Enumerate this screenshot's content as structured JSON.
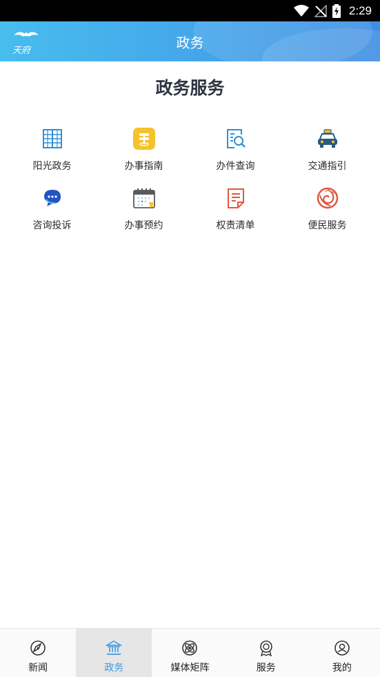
{
  "status_bar": {
    "time": "2:29"
  },
  "header": {
    "title": "政务",
    "logo_text": "天府"
  },
  "section": {
    "title": "政务服务"
  },
  "services": [
    {
      "label": "阳光政务",
      "icon": "building-grid-icon"
    },
    {
      "label": "办事指南",
      "icon": "signpost-icon"
    },
    {
      "label": "办件查询",
      "icon": "document-search-icon"
    },
    {
      "label": "交通指引",
      "icon": "taxi-icon"
    },
    {
      "label": "咨询投诉",
      "icon": "chat-bubble-icon"
    },
    {
      "label": "办事预约",
      "icon": "calendar-icon"
    },
    {
      "label": "权责清单",
      "icon": "checklist-icon"
    },
    {
      "label": "便民服务",
      "icon": "spiral-emblem-icon"
    }
  ],
  "bottom_nav": [
    {
      "label": "新闻",
      "icon": "compass-icon",
      "active": false
    },
    {
      "label": "政务",
      "icon": "government-building-icon",
      "active": true
    },
    {
      "label": "媒体矩阵",
      "icon": "media-orbit-icon",
      "active": false
    },
    {
      "label": "服务",
      "icon": "award-badge-icon",
      "active": false
    },
    {
      "label": "我的",
      "icon": "user-profile-icon",
      "active": false
    }
  ],
  "colors": {
    "header_start": "#47bdee",
    "header_end": "#3f8ee3",
    "active_tab": "#3a9be6",
    "icon_blue": "#2e8fd6",
    "icon_yellow": "#f5c22b",
    "icon_red": "#e2563f"
  }
}
